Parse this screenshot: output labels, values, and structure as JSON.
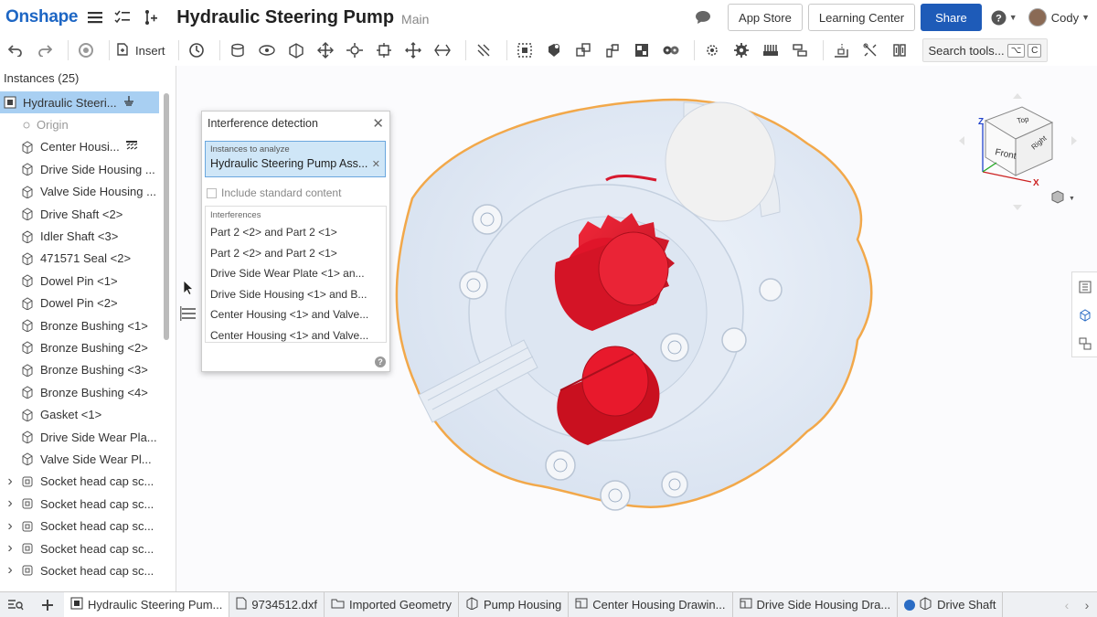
{
  "header": {
    "logo": "Onshape",
    "doc_title": "Hydraulic Steering Pump",
    "branch": "Main",
    "app_store": "App Store",
    "learning_center": "Learning Center",
    "share": "Share",
    "user": "Cody"
  },
  "toolbar": {
    "insert": "Insert",
    "search": "Search tools...",
    "shortcut_1": "⌥",
    "shortcut_2": "C"
  },
  "instances": {
    "title": "Instances (25)",
    "items": [
      {
        "label": "Hydraulic Steeri...",
        "type": "assembly",
        "selected": true
      },
      {
        "label": "Origin",
        "type": "origin"
      },
      {
        "label": "Center Housi...",
        "type": "part",
        "fixed": true
      },
      {
        "label": "Drive Side Housing ...",
        "type": "part"
      },
      {
        "label": "Valve Side Housing ...",
        "type": "part"
      },
      {
        "label": "Drive Shaft <2>",
        "type": "part"
      },
      {
        "label": "Idler Shaft <3>",
        "type": "part"
      },
      {
        "label": "471571 Seal <2>",
        "type": "part"
      },
      {
        "label": "Dowel Pin <1>",
        "type": "part"
      },
      {
        "label": "Dowel Pin <2>",
        "type": "part"
      },
      {
        "label": "Bronze Bushing <1>",
        "type": "part"
      },
      {
        "label": "Bronze Bushing <2>",
        "type": "part"
      },
      {
        "label": "Bronze Bushing <3>",
        "type": "part"
      },
      {
        "label": "Bronze Bushing <4>",
        "type": "part"
      },
      {
        "label": "Gasket <1>",
        "type": "part"
      },
      {
        "label": "Drive Side Wear Pla...",
        "type": "part"
      },
      {
        "label": "Valve Side Wear Pl...",
        "type": "part"
      },
      {
        "label": "Socket head cap sc...",
        "type": "subassembly"
      },
      {
        "label": "Socket head cap sc...",
        "type": "subassembly"
      },
      {
        "label": "Socket head cap sc...",
        "type": "subassembly"
      },
      {
        "label": "Socket head cap sc...",
        "type": "subassembly"
      },
      {
        "label": "Socket head cap sc...",
        "type": "subassembly"
      }
    ]
  },
  "dialog": {
    "title": "Interference detection",
    "instances_label": "Instances to analyze",
    "instances_value": "Hydraulic Steering Pump Ass...",
    "include_standard": "Include standard content",
    "interferences_label": "Interferences",
    "interferences": [
      "Part 2 <2> and Part 2 <1>",
      "Part 2 <2> and Part 2 <1>",
      "Drive Side Wear Plate <1> an...",
      "Drive Side Housing <1> and B...",
      "Center Housing <1> and Valve...",
      "Center Housing <1> and Valve..."
    ]
  },
  "viewcube": {
    "top": "Top",
    "front": "Front",
    "right": "Right",
    "axis_z": "Z",
    "axis_x": "X"
  },
  "tabs": [
    {
      "label": "Hydraulic Steering Pum...",
      "icon": "assembly-icon",
      "active": true
    },
    {
      "label": "9734512.dxf",
      "icon": "file-icon"
    },
    {
      "label": "Imported Geometry",
      "icon": "folder-icon"
    },
    {
      "label": "Pump Housing",
      "icon": "partstudio-icon"
    },
    {
      "label": "Center Housing Drawin...",
      "icon": "drawing-icon"
    },
    {
      "label": "Drive Side Housing Dra...",
      "icon": "drawing-icon"
    },
    {
      "label": "Drive Shaft",
      "icon": "partstudio-icon"
    }
  ],
  "colors": {
    "accent": "#1e5bb8",
    "interference": "#d7192e",
    "selection_outline": "#f2a84a",
    "selected_row": "#a8cff2"
  }
}
